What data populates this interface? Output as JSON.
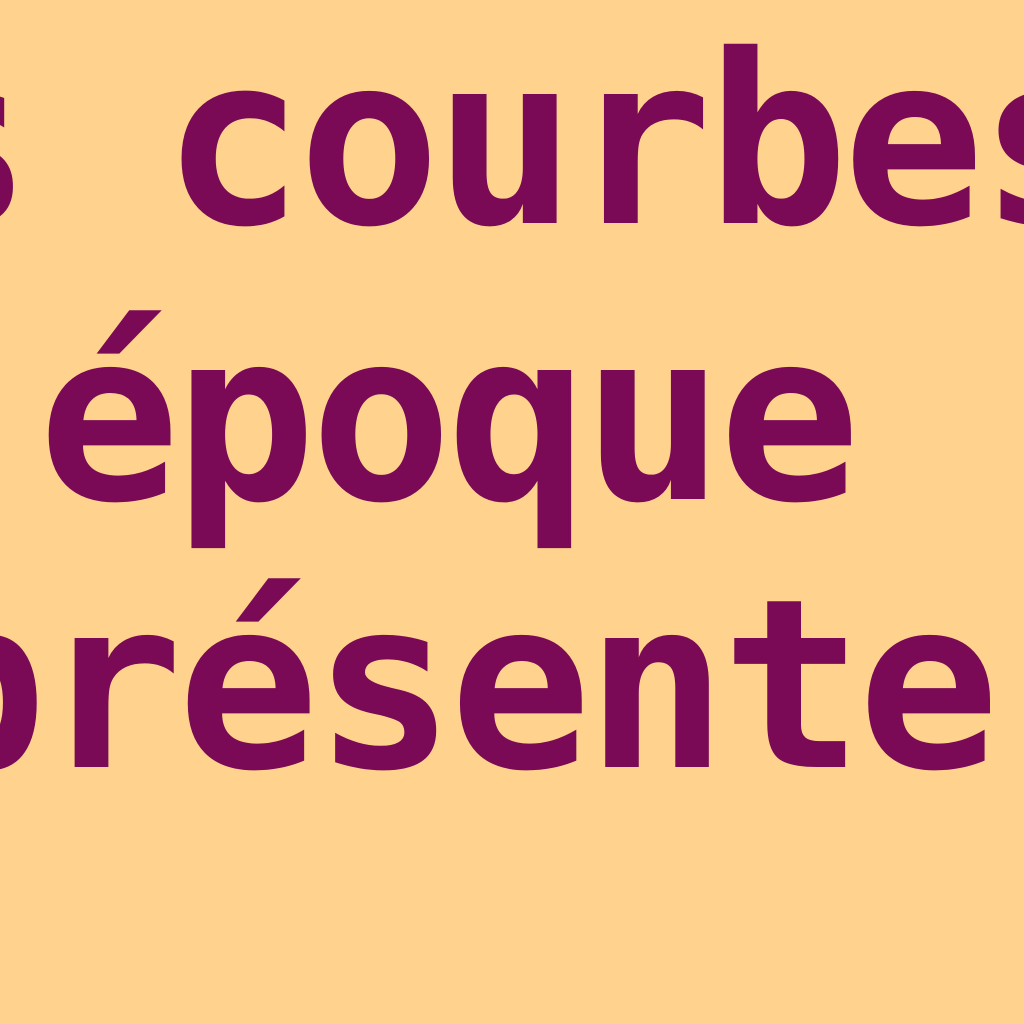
{
  "text": {
    "line1": "s courbes",
    "line2": "'époque",
    "line3": "présenter"
  },
  "colors": {
    "background": "#ffd38d",
    "text": "#7a0a56"
  }
}
